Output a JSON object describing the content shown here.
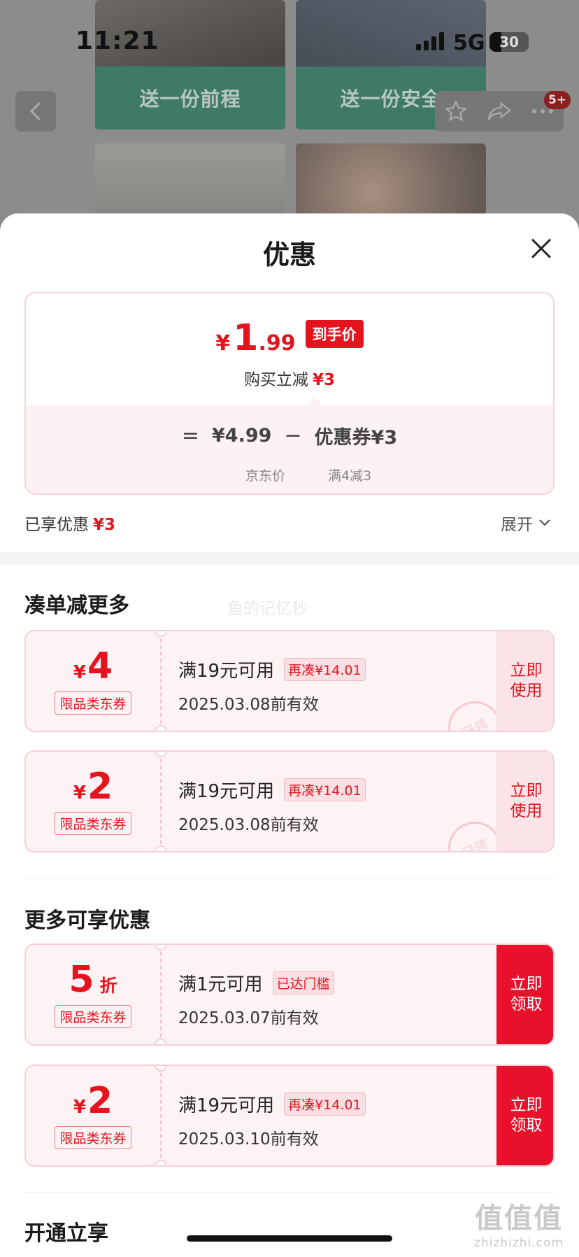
{
  "status_bar": {
    "time": "11:21",
    "network": "5G",
    "battery": "30"
  },
  "background": {
    "card1_cta": "送一份前程",
    "card2_cta": "送一份安全",
    "cart_badge": "5+"
  },
  "sheet": {
    "title": "优惠",
    "price": {
      "currency": "¥",
      "int": "1",
      "decimal": ".99",
      "final_tag": "到手价",
      "instant_label": "购买立减",
      "instant_value": "¥3"
    },
    "breakdown": {
      "equals": "=",
      "jd_price": "¥4.99",
      "minus": "−",
      "coupon_label": "优惠券¥3",
      "jd_price_label": "京东价",
      "coupon_rule": "满4减3"
    },
    "enjoyed_label": "已享优惠",
    "enjoyed_value": "¥3",
    "expand_label": "展开"
  },
  "section1": {
    "title": "凑单减更多",
    "watermark": "鱼的记忆秒",
    "coupons": [
      {
        "sym": "¥",
        "num": "4",
        "unit": "",
        "type": "限品类东券",
        "condition": "满19元可用",
        "tag": "再凑¥14.01",
        "date": "2025.03.08前有效",
        "stamp": "已领",
        "action": "立即\n使用"
      },
      {
        "sym": "¥",
        "num": "2",
        "unit": "",
        "type": "限品类东券",
        "condition": "满19元可用",
        "tag": "再凑¥14.01",
        "date": "2025.03.08前有效",
        "stamp": "已领",
        "action": "立即\n使用"
      }
    ]
  },
  "section2": {
    "title": "更多可享优惠",
    "coupons": [
      {
        "sym": "",
        "num": "5",
        "unit": "折",
        "type": "限品类东券",
        "condition": "满1元可用",
        "tag": "已达门槛",
        "date": "2025.03.07前有效",
        "action": "立即\n领取"
      },
      {
        "sym": "¥",
        "num": "2",
        "unit": "",
        "type": "限品类东券",
        "condition": "满19元可用",
        "tag": "再凑¥14.01",
        "date": "2025.03.10前有效",
        "action": "立即\n领取"
      }
    ]
  },
  "section3": {
    "title": "开通立享"
  },
  "site_watermark": {
    "big": "值值值",
    "small": "zhizhizhi.com"
  },
  "colors": {
    "accent": "#e4141f",
    "coupon_bg": "#fdf3f4",
    "cta_green": "#3f7a66"
  }
}
